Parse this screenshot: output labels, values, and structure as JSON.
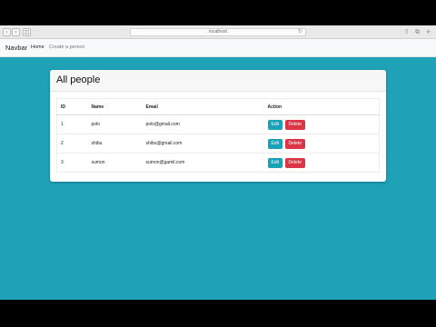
{
  "browser": {
    "url": "localhost"
  },
  "navbar": {
    "brand": "Navbar",
    "links": [
      {
        "label": "Home"
      },
      {
        "label": "Create a person"
      }
    ]
  },
  "card": {
    "title": "All people",
    "table": {
      "headers": [
        "ID",
        "Name",
        "Email",
        "Action"
      ],
      "rows": [
        {
          "id": "1",
          "name": "polo",
          "email": "polo@gmail.com"
        },
        {
          "id": "2",
          "name": "shibu",
          "email": "shibu@gmail.com"
        },
        {
          "id": "3",
          "name": "sumon",
          "email": "sumon@gamil.com"
        }
      ],
      "edit_label": "Edit",
      "delete_label": "Delete"
    }
  },
  "colors": {
    "background": "#1fa2b8",
    "edit": "#17a2b8",
    "delete": "#dc3545"
  }
}
